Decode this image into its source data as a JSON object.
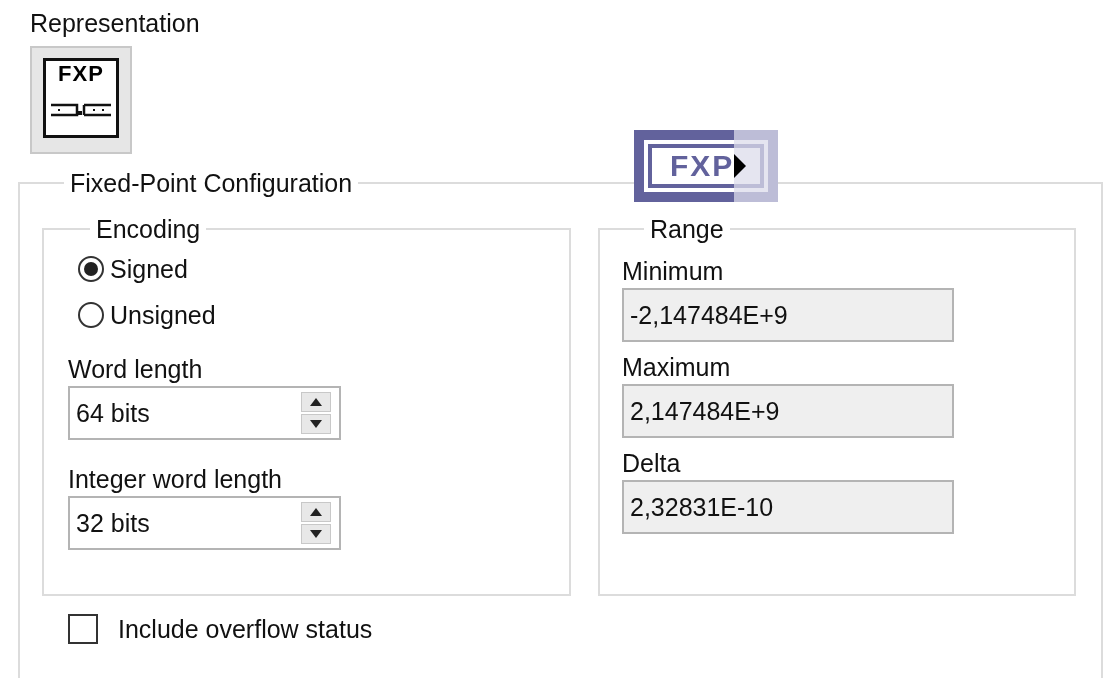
{
  "representation": {
    "label": "Representation",
    "icon_text": "FXP"
  },
  "indicator": {
    "text": "FXP"
  },
  "config": {
    "title": "Fixed-Point Configuration",
    "encoding": {
      "title": "Encoding",
      "options": [
        {
          "label": "Signed",
          "selected": true
        },
        {
          "label": "Unsigned",
          "selected": false
        }
      ],
      "word_length": {
        "label": "Word length",
        "value": "64 bits"
      },
      "integer_word_length": {
        "label": "Integer word length",
        "value": "32 bits"
      }
    },
    "range": {
      "title": "Range",
      "fields": [
        {
          "label": "Minimum",
          "value": "-2,147484E+9"
        },
        {
          "label": "Maximum",
          "value": "2,147484E+9"
        },
        {
          "label": "Delta",
          "value": "2,32831E-10"
        }
      ]
    },
    "overflow": {
      "label": "Include overflow status",
      "checked": false
    }
  }
}
